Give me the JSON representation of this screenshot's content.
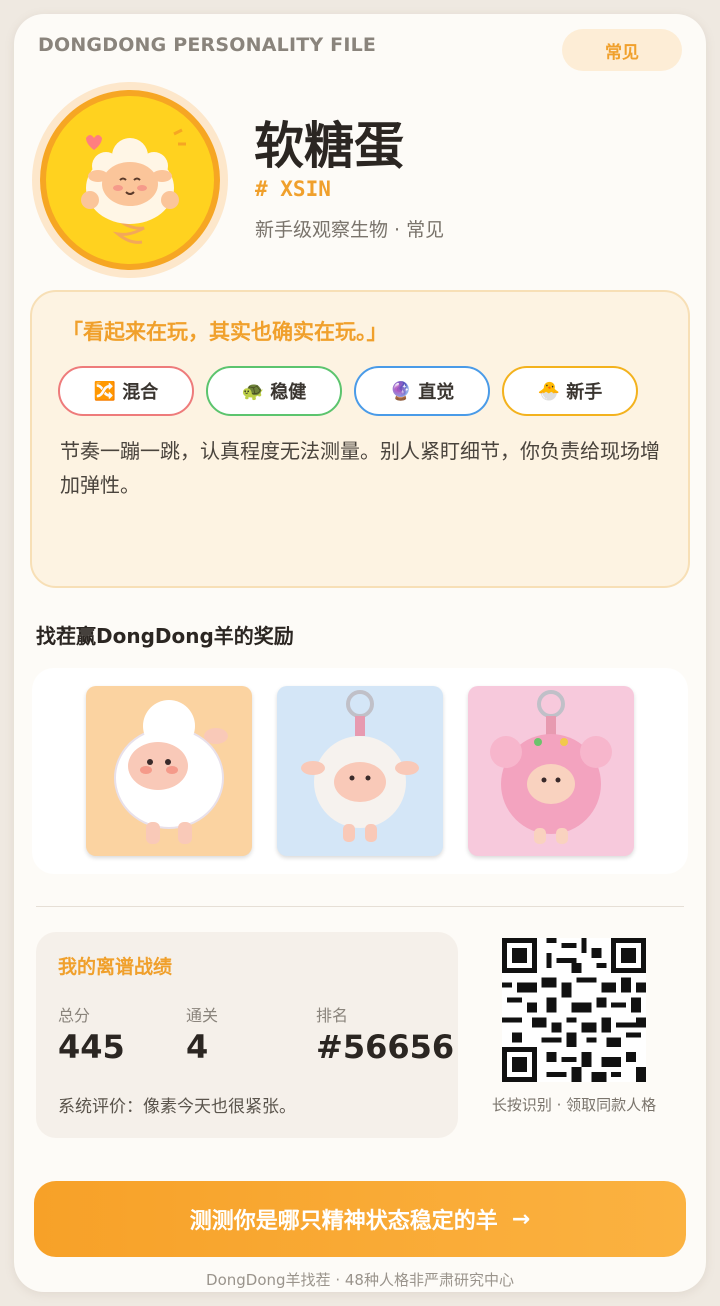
{
  "header": {
    "file_title": "DONGDONG PERSONALITY FILE",
    "rarity": "常见"
  },
  "profile": {
    "name": "软糖蛋",
    "code": "# XSIN",
    "subtitle": "新手级观察生物 · 常见"
  },
  "quote_card": {
    "quote": "「看起来在玩，其实也确实在玩。」",
    "tags": [
      {
        "icon": "🔀",
        "icon_name": "shuffle-icon",
        "label": "混合",
        "color": "#ee7b7b"
      },
      {
        "icon": "🐢",
        "icon_name": "turtle-icon",
        "label": "稳健",
        "color": "#5cc46e"
      },
      {
        "icon": "🔮",
        "icon_name": "crystal-ball-icon",
        "label": "直觉",
        "color": "#4a9be8"
      },
      {
        "icon": "🐣",
        "icon_name": "hatching-chick-icon",
        "label": "新手",
        "color": "#f3b21e"
      }
    ],
    "description": "节奏一蹦一跳，认真程度无法测量。别人紧盯细节，你负责给现场增加弹性。"
  },
  "rewards": {
    "title": "找茬赢DongDong羊的奖励",
    "items": [
      {
        "bg": "#fbd3a1"
      },
      {
        "bg": "#d4e6f7"
      },
      {
        "bg": "#f7c9dc"
      }
    ]
  },
  "stats": {
    "title": "我的离谱战绩",
    "score_label": "总分",
    "score": "445",
    "clears_label": "通关",
    "clears": "4",
    "rank_label": "排名",
    "rank": "#56656",
    "rating": "系统评价：像素今天也很紧张。"
  },
  "qr": {
    "caption": "长按识别 · 领取同款人格"
  },
  "cta": {
    "label": "测测你是哪只精神状态稳定的羊",
    "arrow": "→"
  },
  "footer": {
    "text": "DongDong羊找茬 · 48种人格非严肃研究中心"
  },
  "colors": {
    "accent": "#f0a02c",
    "card_bg": "#fdfbf7",
    "quote_bg": "#fdf3e2"
  }
}
